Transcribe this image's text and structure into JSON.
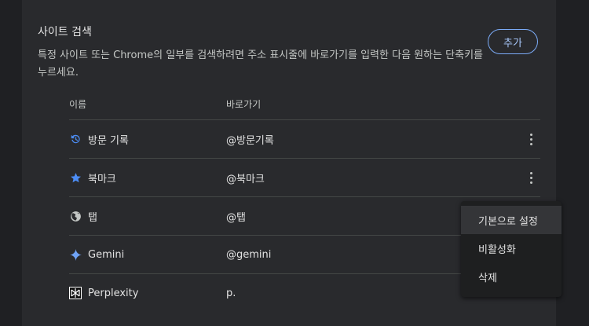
{
  "site_search": {
    "title": "사이트 검색",
    "description": "특정 사이트 또는 Chrome의 일부를 검색하려면 주소 표시줄에 바로가기를 입력한 다음 원하는 단축키를 누르세요.",
    "add_label": "추가"
  },
  "table": {
    "col_name": "이름",
    "col_shortcut": "바로가기",
    "rows": [
      {
        "name": "방문 기록",
        "shortcut": "@방문기록",
        "icon": "history-icon"
      },
      {
        "name": "북마크",
        "shortcut": "@북마크",
        "icon": "star-icon"
      },
      {
        "name": "탭",
        "shortcut": "@탭",
        "icon": "globe-icon"
      },
      {
        "name": "Gemini",
        "shortcut": "@gemini",
        "icon": "gemini-sparkle-icon"
      },
      {
        "name": "Perplexity",
        "shortcut": "p.",
        "icon": "perplexity-logo-icon"
      }
    ]
  },
  "context_menu": {
    "items": [
      "기본으로 설정",
      "비활성화",
      "삭제"
    ]
  },
  "colors": {
    "accent": "#a8c7fa",
    "icon_blue": "#4c8df6",
    "background": "#1f2023",
    "card": "#292a2d"
  }
}
